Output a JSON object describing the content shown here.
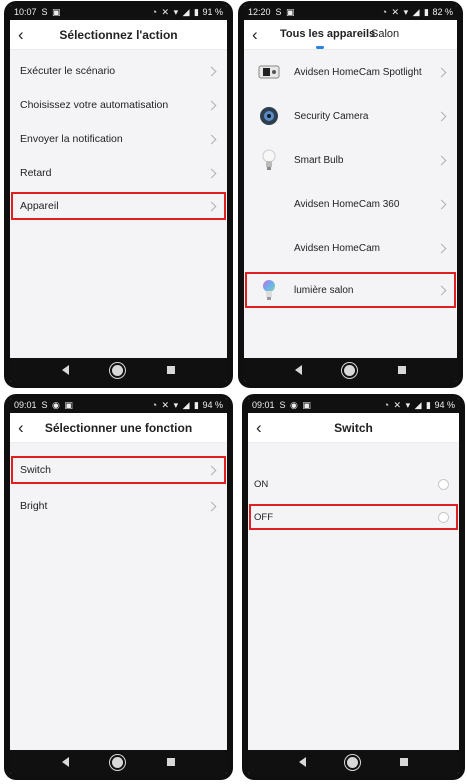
{
  "screens": [
    {
      "status": {
        "time": "10:07",
        "left_icons": "S ▣",
        "right_icons": "◔ ✕ ▾ ◢ ▮",
        "battery": "91 %"
      },
      "title": "Sélectionnez l'action",
      "items": [
        {
          "label": "Exécuter le scénario"
        },
        {
          "label": "Choisissez votre automatisation"
        },
        {
          "label": "Envoyer la notification"
        },
        {
          "label": "Retard"
        },
        {
          "label": "Appareil",
          "highlighted": true
        }
      ]
    },
    {
      "status": {
        "time": "12:20",
        "left_icons": "S ▣",
        "right_icons": "◔ ✕ ▾ ◢ ▮",
        "battery": "82 %"
      },
      "tabs": [
        {
          "label": "Tous les appareils",
          "active": true
        },
        {
          "label": "Salon",
          "active": false
        }
      ],
      "devices": [
        {
          "label": "Avidsen HomeCam Spotlight",
          "icon": "spotlight-camera-icon"
        },
        {
          "label": "Security Camera",
          "icon": "security-camera-icon"
        },
        {
          "label": "Smart Bulb",
          "icon": "smart-bulb-icon"
        },
        {
          "label": "Avidsen HomeCam 360",
          "icon": ""
        },
        {
          "label": "Avidsen HomeCam",
          "icon": ""
        },
        {
          "label": "lumière salon",
          "icon": "color-bulb-icon",
          "highlighted": true
        }
      ]
    },
    {
      "status": {
        "time": "09:01",
        "left_icons": "S ◉ ▣",
        "right_icons": "◔ ✕ ▾ ◢ ▮",
        "battery": "94 %"
      },
      "title": "Sélectionner une fonction",
      "items": [
        {
          "label": "Switch",
          "highlighted": true
        },
        {
          "label": "Bright"
        }
      ]
    },
    {
      "status": {
        "time": "09:01",
        "left_icons": "S ◉ ▣",
        "right_icons": "◔ ✕ ▾ ◢ ▮",
        "battery": "94 %"
      },
      "title": "Switch",
      "options": [
        {
          "label": "ON"
        },
        {
          "label": "OFF",
          "highlighted": true
        }
      ]
    }
  ],
  "colors": {
    "highlight": "#e02020",
    "accent": "#2a82e4",
    "background": "#f4f4f6"
  }
}
